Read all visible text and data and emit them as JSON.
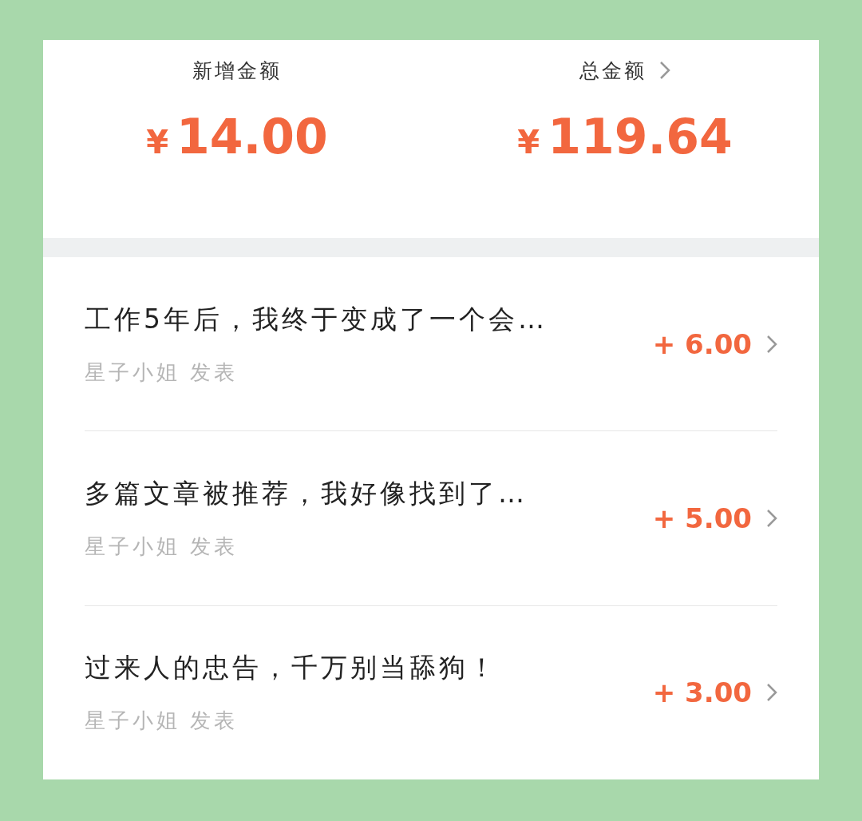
{
  "summary": [
    {
      "label": "新增金额",
      "currency": "¥",
      "amount": "14.00",
      "has_link": false
    },
    {
      "label": "总金额",
      "currency": "¥",
      "amount": "119.64",
      "has_link": true
    }
  ],
  "articles": [
    {
      "title": "工作5年后，我终于变成了一个会…",
      "byline": "星子小姐 发表",
      "reward": "+ 6.00"
    },
    {
      "title": "多篇文章被推荐，我好像找到了…",
      "byline": "星子小姐 发表",
      "reward": "+ 5.00"
    },
    {
      "title": "过来人的忠告，千万别当舔狗！",
      "byline": "星子小姐 发表",
      "reward": "+ 3.00"
    }
  ]
}
